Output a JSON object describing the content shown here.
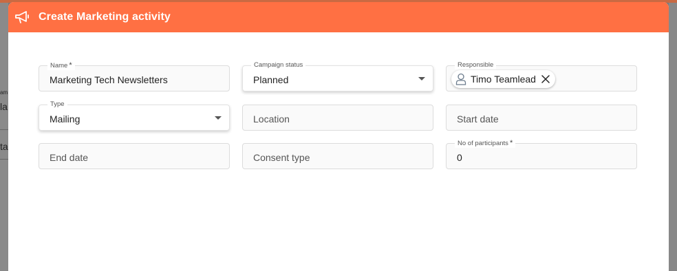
{
  "dialog": {
    "title": "Create Marketing activity",
    "icon": "megaphone-icon"
  },
  "background": {
    "left_fragments": [
      "am",
      "la",
      "ta"
    ]
  },
  "fields": {
    "name": {
      "label": "Name",
      "required": "*",
      "value": "Marketing Tech Newsletters"
    },
    "campaign_status": {
      "label": "Campaign status",
      "value": "Planned"
    },
    "responsible": {
      "label": "Responsible",
      "chip": "Timo Teamlead"
    },
    "type": {
      "label": "Type",
      "value": "Mailing"
    },
    "location": {
      "placeholder": "Location"
    },
    "start_date": {
      "placeholder": "Start date"
    },
    "end_date": {
      "placeholder": "End date"
    },
    "consent_type": {
      "placeholder": "Consent type"
    },
    "participants": {
      "label": "No of participants",
      "required": "*",
      "value": "0"
    }
  },
  "colors": {
    "header": "#ff7043",
    "topbar": "#c96a43"
  }
}
